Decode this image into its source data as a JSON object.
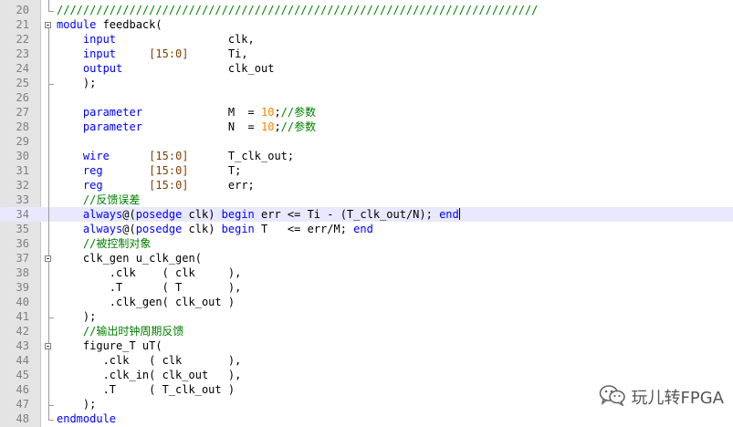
{
  "editor": {
    "current_line": 34,
    "lines": [
      {
        "n": "20",
        "tokens": [
          {
            "c": "cmt",
            "t": "/////////////////////////////////////////////////////////////////////////"
          }
        ]
      },
      {
        "n": "21",
        "tokens": [
          {
            "c": "kw",
            "t": "module"
          },
          {
            "c": "plain",
            "t": " feedback("
          }
        ]
      },
      {
        "n": "22",
        "tokens": [
          {
            "c": "plain",
            "t": "    "
          },
          {
            "c": "kw",
            "t": "input"
          },
          {
            "c": "plain",
            "t": "                 clk,"
          }
        ]
      },
      {
        "n": "23",
        "tokens": [
          {
            "c": "plain",
            "t": "    "
          },
          {
            "c": "kw",
            "t": "input"
          },
          {
            "c": "plain",
            "t": "     "
          },
          {
            "c": "bus",
            "t": "[15:0]"
          },
          {
            "c": "plain",
            "t": "      Ti,"
          }
        ]
      },
      {
        "n": "24",
        "tokens": [
          {
            "c": "plain",
            "t": "    "
          },
          {
            "c": "kw",
            "t": "output"
          },
          {
            "c": "plain",
            "t": "                clk_out"
          }
        ]
      },
      {
        "n": "25",
        "tokens": [
          {
            "c": "plain",
            "t": "    );"
          }
        ]
      },
      {
        "n": "26",
        "tokens": []
      },
      {
        "n": "27",
        "tokens": [
          {
            "c": "plain",
            "t": "    "
          },
          {
            "c": "kw",
            "t": "parameter"
          },
          {
            "c": "plain",
            "t": "             M  = "
          },
          {
            "c": "num",
            "t": "10"
          },
          {
            "c": "plain",
            "t": ";"
          },
          {
            "c": "cmt",
            "t": "//参数"
          }
        ]
      },
      {
        "n": "28",
        "tokens": [
          {
            "c": "plain",
            "t": "    "
          },
          {
            "c": "kw",
            "t": "parameter"
          },
          {
            "c": "plain",
            "t": "             N  = "
          },
          {
            "c": "num",
            "t": "10"
          },
          {
            "c": "plain",
            "t": ";"
          },
          {
            "c": "cmt",
            "t": "//参数"
          }
        ]
      },
      {
        "n": "29",
        "tokens": []
      },
      {
        "n": "30",
        "tokens": [
          {
            "c": "plain",
            "t": "    "
          },
          {
            "c": "kw",
            "t": "wire"
          },
          {
            "c": "plain",
            "t": "      "
          },
          {
            "c": "bus",
            "t": "[15:0]"
          },
          {
            "c": "plain",
            "t": "      T_clk_out;"
          }
        ]
      },
      {
        "n": "31",
        "tokens": [
          {
            "c": "plain",
            "t": "    "
          },
          {
            "c": "kw",
            "t": "reg"
          },
          {
            "c": "plain",
            "t": "       "
          },
          {
            "c": "bus",
            "t": "[15:0]"
          },
          {
            "c": "plain",
            "t": "      T;"
          }
        ]
      },
      {
        "n": "32",
        "tokens": [
          {
            "c": "plain",
            "t": "    "
          },
          {
            "c": "kw",
            "t": "reg"
          },
          {
            "c": "plain",
            "t": "       "
          },
          {
            "c": "bus",
            "t": "[15:0]"
          },
          {
            "c": "plain",
            "t": "      err;"
          }
        ]
      },
      {
        "n": "33",
        "tokens": [
          {
            "c": "plain",
            "t": "    "
          },
          {
            "c": "cmt",
            "t": "//反馈误差"
          }
        ]
      },
      {
        "n": "34",
        "tokens": [
          {
            "c": "plain",
            "t": "    "
          },
          {
            "c": "kw",
            "t": "always"
          },
          {
            "c": "plain",
            "t": "@("
          },
          {
            "c": "kw",
            "t": "posedge"
          },
          {
            "c": "plain",
            "t": " clk) "
          },
          {
            "c": "kw",
            "t": "begin"
          },
          {
            "c": "plain",
            "t": " err <= Ti - (T_clk_out/N); "
          },
          {
            "c": "kw",
            "t": "end"
          },
          {
            "c": "caret",
            "t": ""
          }
        ]
      },
      {
        "n": "35",
        "tokens": [
          {
            "c": "plain",
            "t": "    "
          },
          {
            "c": "kw",
            "t": "always"
          },
          {
            "c": "plain",
            "t": "@("
          },
          {
            "c": "kw",
            "t": "posedge"
          },
          {
            "c": "plain",
            "t": " clk) "
          },
          {
            "c": "kw",
            "t": "begin"
          },
          {
            "c": "plain",
            "t": " T   <= err/M; "
          },
          {
            "c": "kw",
            "t": "end"
          }
        ]
      },
      {
        "n": "36",
        "tokens": [
          {
            "c": "plain",
            "t": "    "
          },
          {
            "c": "cmt",
            "t": "//被控制对象"
          }
        ]
      },
      {
        "n": "37",
        "tokens": [
          {
            "c": "plain",
            "t": "    clk_gen u_clk_gen("
          }
        ]
      },
      {
        "n": "38",
        "tokens": [
          {
            "c": "plain",
            "t": "        .clk    ( clk     ),"
          }
        ]
      },
      {
        "n": "39",
        "tokens": [
          {
            "c": "plain",
            "t": "        .T      ( T       ),"
          }
        ]
      },
      {
        "n": "40",
        "tokens": [
          {
            "c": "plain",
            "t": "        .clk_gen( clk_out )"
          }
        ]
      },
      {
        "n": "41",
        "tokens": [
          {
            "c": "plain",
            "t": "    );"
          }
        ]
      },
      {
        "n": "42",
        "tokens": [
          {
            "c": "plain",
            "t": "    "
          },
          {
            "c": "cmt",
            "t": "//输出时钟周期反馈"
          }
        ]
      },
      {
        "n": "43",
        "tokens": [
          {
            "c": "plain",
            "t": "    figure_T uT("
          }
        ]
      },
      {
        "n": "44",
        "tokens": [
          {
            "c": "plain",
            "t": "       .clk   ( clk       ),"
          }
        ]
      },
      {
        "n": "45",
        "tokens": [
          {
            "c": "plain",
            "t": "       .clk_in( clk_out   ),"
          }
        ]
      },
      {
        "n": "46",
        "tokens": [
          {
            "c": "plain",
            "t": "       .T     ( T_clk_out )"
          }
        ]
      },
      {
        "n": "47",
        "tokens": [
          {
            "c": "plain",
            "t": "    );"
          }
        ]
      },
      {
        "n": "48",
        "tokens": [
          {
            "c": "kw",
            "t": "endmodule"
          }
        ]
      }
    ],
    "colors": {
      "keyword": "#0000ff",
      "number": "#ff8000",
      "bus": "#804000",
      "comment": "#008000",
      "current_line_bg": "#e8e8ff",
      "gutter_bg": "#e4e4e4"
    }
  },
  "watermark": {
    "icon": "wechat-icon",
    "text": "玩儿转FPGA"
  }
}
